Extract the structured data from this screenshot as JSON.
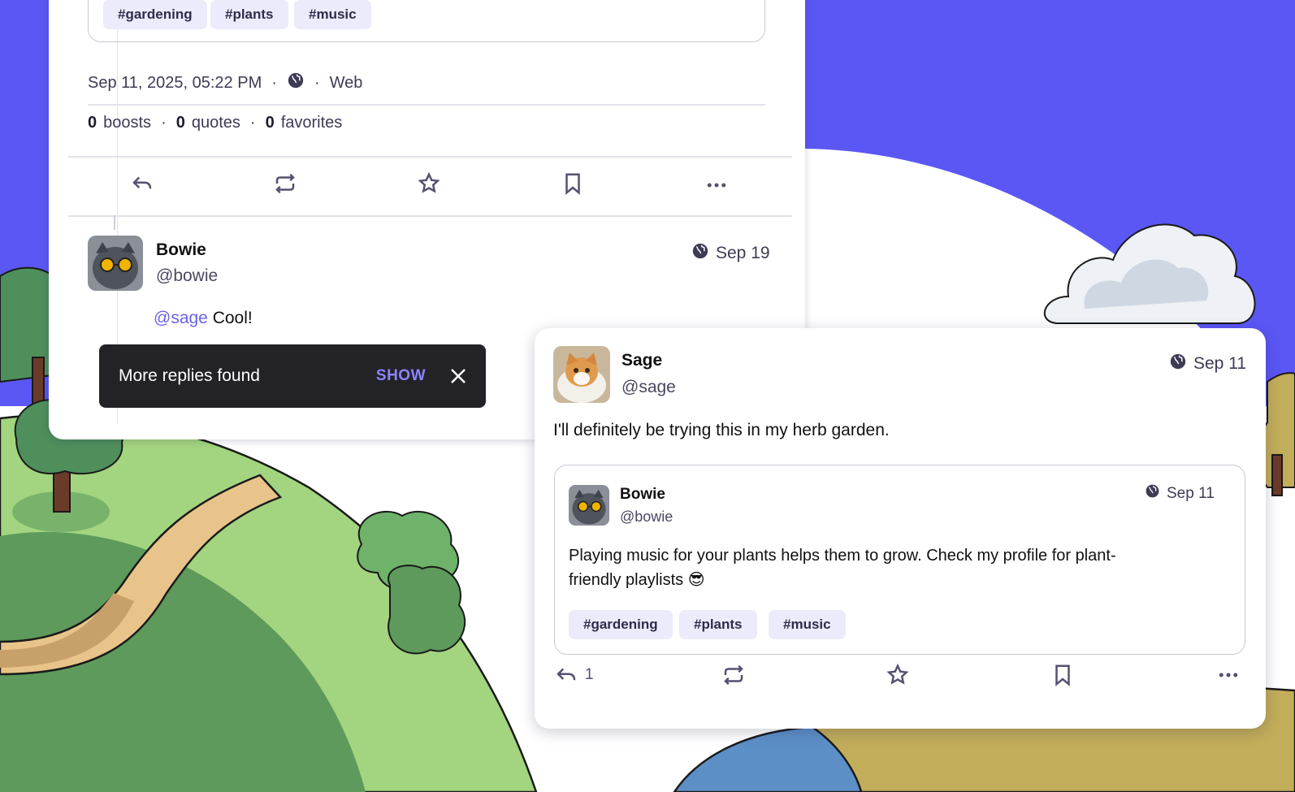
{
  "main_post": {
    "quote_tags": [
      "#gardening",
      "#plants",
      "#music"
    ],
    "meta": {
      "datetime": "Sep 11, 2025, 05:22 PM",
      "separator": "·",
      "client": "Web",
      "visibility_icon": "globe-icon"
    },
    "stats": [
      {
        "count": "0",
        "label": "boosts"
      },
      {
        "count": "0",
        "label": "quotes"
      },
      {
        "count": "0",
        "label": "favorites"
      }
    ],
    "actions": [
      "reply-icon",
      "boost-icon",
      "favorite-icon",
      "bookmark-icon",
      "more-icon"
    ]
  },
  "reply": {
    "name": "Bowie",
    "handle": "@bowie",
    "date": "Sep 19",
    "mention": "@sage",
    "text": " Cool!"
  },
  "toast": {
    "message": "More replies found",
    "action": "SHOW"
  },
  "popup": {
    "name": "Sage",
    "handle": "@sage",
    "date": "Sep 11",
    "text": "I'll definitely be trying this in my herb garden.",
    "quote": {
      "name": "Bowie",
      "handle": "@bowie",
      "date": "Sep 11",
      "text_line1": "Playing music for your plants helps them to grow. Check my profile for plant-",
      "text_line2": "friendly playlists 😎",
      "tags": [
        "#gardening",
        "#plants",
        "#music"
      ]
    },
    "reply_count": "1"
  },
  "colors": {
    "background": "#5b57f5",
    "accent": "#6a62e6",
    "tag_bg": "#ecebfb",
    "toast_bg": "#232226"
  }
}
